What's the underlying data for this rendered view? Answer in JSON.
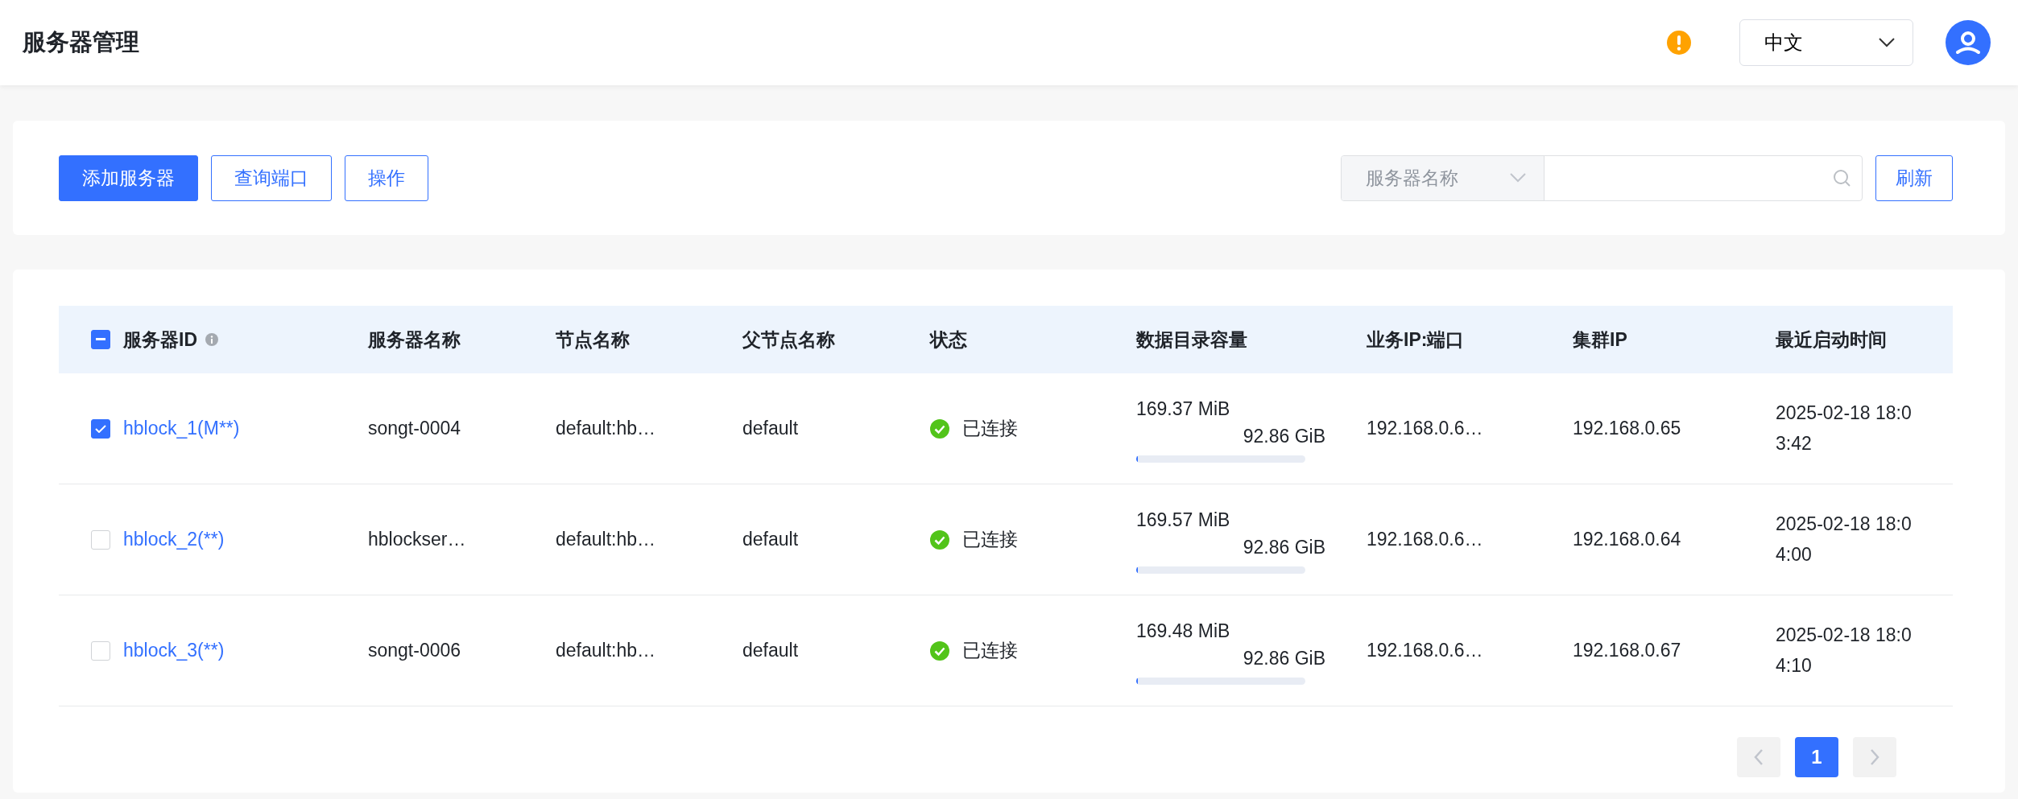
{
  "header": {
    "title": "服务器管理",
    "language_select": {
      "value": "中文"
    }
  },
  "toolbar": {
    "buttons": [
      {
        "label": "添加服务器",
        "kind": "primary"
      },
      {
        "label": "查询端口",
        "kind": "outline"
      },
      {
        "label": "操作",
        "kind": "outline"
      }
    ],
    "search": {
      "field_select": "服务器名称"
    },
    "refresh_button": "刷新"
  },
  "table": {
    "select_all": {
      "indeterminate": true
    },
    "columns": [
      {
        "label": "服务器ID",
        "info": true
      },
      {
        "label": "服务器名称",
        "info": false
      },
      {
        "label": "节点名称",
        "info": false
      },
      {
        "label": "父节点名称",
        "info": false
      },
      {
        "label": "状态",
        "info": false
      },
      {
        "label": "数据目录容量",
        "info": false
      },
      {
        "label": "业务IP:端口",
        "info": false
      },
      {
        "label": "集群IP",
        "info": false
      },
      {
        "label": "最近启动时间",
        "info": false
      }
    ],
    "rows": [
      {
        "checked": true,
        "server_id": "hblock_1(M**)",
        "server_name": "songt-0004",
        "node_name": "default:hb…",
        "parent_node": "default",
        "status": "已连接",
        "capacity_used": "169.37 MiB",
        "capacity_total": "92.86 GiB",
        "level": 0.002,
        "business_ip_port": "192.168.0.6…",
        "cluster_ip": "192.168.0.65",
        "last_start": "2025-02-18 18:03:42"
      },
      {
        "checked": false,
        "server_id": "hblock_2(**)",
        "server_name": "hblockser…",
        "node_name": "default:hb…",
        "parent_node": "default",
        "status": "已连接",
        "capacity_used": "169.57 MiB",
        "capacity_total": "92.86 GiB",
        "level": 0.002,
        "business_ip_port": "192.168.0.6…",
        "cluster_ip": "192.168.0.64",
        "last_start": "2025-02-18 18:04:00"
      },
      {
        "checked": false,
        "server_id": "hblock_3(**)",
        "server_name": "songt-0006",
        "node_name": "default:hb…",
        "parent_node": "default",
        "status": "已连接",
        "capacity_used": "169.48 MiB",
        "capacity_total": "92.86 GiB",
        "level": 0.002,
        "business_ip_port": "192.168.0.6…",
        "cluster_ip": "192.168.0.67",
        "last_start": "2025-02-18 18:04:10"
      }
    ]
  },
  "pagination": {
    "prev_disabled": true,
    "next_disabled": true,
    "pages": [
      {
        "label": "1",
        "selected": true
      }
    ]
  }
}
